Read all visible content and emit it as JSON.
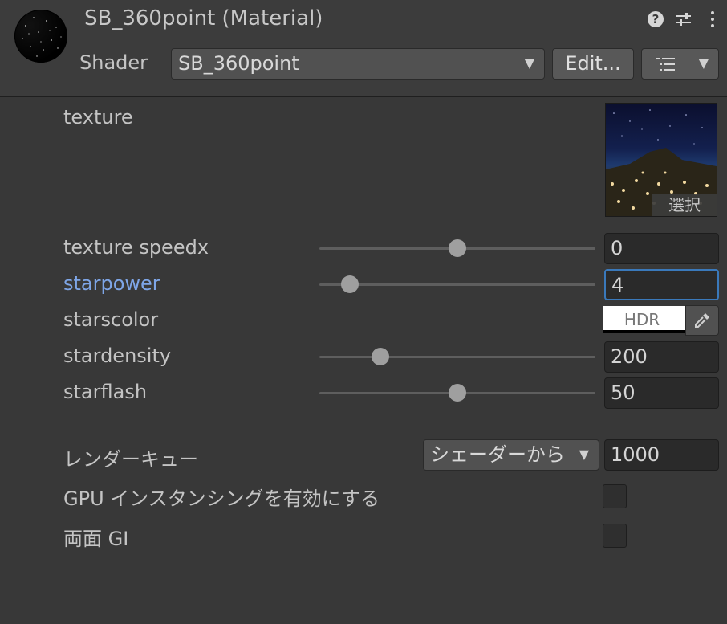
{
  "header": {
    "title": "SB_360point (Material)",
    "shader_label": "Shader",
    "shader_value": "SB_360point",
    "edit_button": "Edit...",
    "icons": [
      "help-icon",
      "preset-icon",
      "kebab-menu-icon",
      "list-icon",
      "chevron-down-icon"
    ]
  },
  "properties": {
    "texture": {
      "label": "texture",
      "select_label": "選択"
    },
    "texture_speedx": {
      "label": "texture speedx",
      "value": "0",
      "slider_fraction": 0.5
    },
    "starpower": {
      "label": "starpower",
      "value": "4",
      "slider_fraction": 0.11
    },
    "starscolor": {
      "label": "starscolor",
      "hdr_label": "HDR",
      "color": "#ffffff"
    },
    "stardensity": {
      "label": "stardensity",
      "value": "200",
      "slider_fraction": 0.22
    },
    "starflash": {
      "label": "starflash",
      "value": "50",
      "slider_fraction": 0.5
    }
  },
  "advanced": {
    "render_queue_label": "レンダーキュー",
    "render_queue_dropdown": "シェーダーから",
    "render_queue_value": "1000",
    "gpu_instancing_label": "GPU インスタンシングを有効にする",
    "double_sided_gi_label": "両面 GI"
  },
  "colors": {
    "accent": "#7ea6e8",
    "focus": "#3a79bb",
    "background": "#383838"
  }
}
